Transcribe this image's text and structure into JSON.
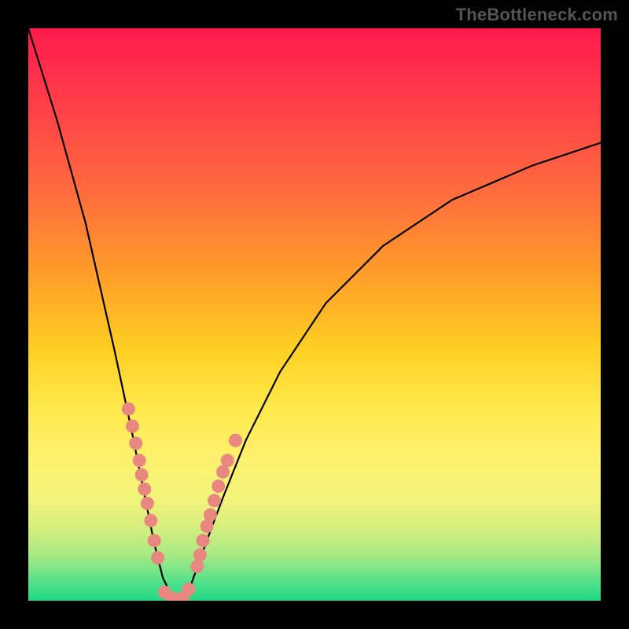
{
  "watermark": "TheBottleneck.com",
  "chart_data": {
    "type": "line",
    "title": "",
    "xlabel": "",
    "ylabel": "",
    "xlim": [
      0,
      100
    ],
    "ylim": [
      0,
      100
    ],
    "grid": false,
    "background_gradient": {
      "from": "#ff1a4d",
      "to": "#1fd885",
      "direction": "top-to-bottom"
    },
    "curve": {
      "description": "V-shaped bottleneck curve reaching 0 near x≈26 and rising on both sides",
      "x": [
        0,
        5,
        10,
        15,
        18,
        20,
        22,
        23.5,
        25,
        26,
        27,
        28.5,
        31,
        34,
        38,
        44,
        52,
        62,
        74,
        88,
        100
      ],
      "y": [
        100,
        84,
        66,
        44,
        30,
        20,
        10,
        4,
        1,
        0,
        0.5,
        3,
        10,
        18,
        28,
        40,
        52,
        62,
        70,
        76,
        80
      ]
    },
    "series": [
      {
        "name": "left-cluster-dots",
        "color": "#e98880",
        "x": [
          17.5,
          18.2,
          18.8,
          19.4,
          19.8,
          20.3,
          20.8,
          21.4,
          22.0,
          22.6
        ],
        "y": [
          33.5,
          30.5,
          27.5,
          24.5,
          22.0,
          19.5,
          17.0,
          14.0,
          10.5,
          7.5
        ]
      },
      {
        "name": "right-cluster-dots",
        "color": "#e98880",
        "x": [
          29.5,
          30.0,
          30.5,
          31.2,
          31.8,
          32.5,
          33.2,
          34.0,
          34.8,
          36.2
        ],
        "y": [
          6.0,
          8.0,
          10.5,
          13.0,
          15.0,
          17.5,
          20.0,
          22.5,
          24.5,
          28.0
        ]
      },
      {
        "name": "bottom-dots",
        "color": "#e98880",
        "x": [
          23.8,
          25.0,
          26.0,
          27.0,
          28.0
        ],
        "y": [
          1.5,
          0.5,
          0.3,
          0.5,
          2.0
        ]
      }
    ]
  }
}
